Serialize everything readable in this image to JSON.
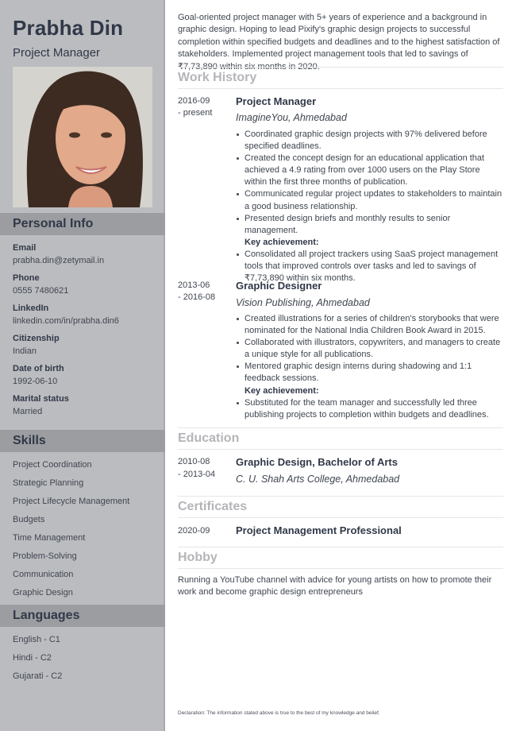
{
  "header": {
    "name": "Prabha Din",
    "role": "Project Manager"
  },
  "photo": {
    "alt": "profile-photo of smiling woman with long dark hair"
  },
  "personal_info": {
    "title": "Personal Info",
    "items": [
      {
        "label": "Email",
        "value": "prabha.din@zetymail.in"
      },
      {
        "label": "Phone",
        "value": "0555 7480621"
      },
      {
        "label": "LinkedIn",
        "value": "linkedin.com/in/prabha.din6"
      },
      {
        "label": "Citizenship",
        "value": "Indian"
      },
      {
        "label": "Date of birth",
        "value": "1992-06-10"
      },
      {
        "label": "Marital status",
        "value": "Married"
      }
    ]
  },
  "skills": {
    "title": "Skills",
    "items": [
      "Project Coordination",
      "Strategic Planning",
      "Project Lifecycle Management",
      "Budgets",
      "Time Management",
      "Problem-Solving",
      "Communication",
      "Graphic Design"
    ]
  },
  "languages": {
    "title": "Languages",
    "items": [
      "English - C1",
      "Hindi - C2",
      "Gujarati - C2"
    ]
  },
  "summary": "Goal-oriented project manager with 5+ years of experience and a background in graphic design. Hoping to lead Pixify's graphic design projects to successful completion within specified budgets and deadlines and to the highest satisfaction of stakeholders. Implemented project management tools that led to savings of ₹7,73,890 within six months in 2020.",
  "work_history": {
    "title": "Work History",
    "jobs": [
      {
        "date_start": "2016-09",
        "date_end": "- present",
        "title": "Project Manager",
        "company": "ImagineYou, Ahmedabad",
        "bullets": [
          "Coordinated graphic design projects with 97% delivered before specified deadlines.",
          "Created the concept design for an educational application that achieved a 4.9 rating from over 1000 users on the Play Store within the first three months of publication.",
          "Communicated regular project updates to stakeholders to maintain a good business relationship.",
          "Presented design briefs and monthly results to senior management."
        ],
        "key_label": "Key achievement:",
        "key_bullets": [
          "Consolidated all project trackers using SaaS project management tools that improved controls over tasks and led to savings of ₹7,73,890 within six months."
        ]
      },
      {
        "date_start": "2013-06",
        "date_end": "- 2016-08",
        "title": "Graphic Designer",
        "company": "Vision Publishing, Ahmedabad",
        "bullets": [
          "Created illustrations for a series of children's storybooks that were nominated for the National India Children Book Award in 2015.",
          "Collaborated with illustrators, copywriters, and managers to create a unique style for all publications.",
          "Mentored graphic design interns during shadowing and 1:1 feedback sessions."
        ],
        "key_label": "Key achievement:",
        "key_bullets": [
          "Substituted for the team manager and successfully led three publishing projects to completion within budgets and deadlines."
        ]
      }
    ]
  },
  "education": {
    "title": "Education",
    "date_start": "2010-08",
    "date_end": "- 2013-04",
    "degree": "Graphic Design, Bachelor of Arts",
    "school": "C. U. Shah Arts College, Ahmedabad"
  },
  "certificates": {
    "title": "Certificates",
    "date": "2020-09",
    "name": "Project Management Professional"
  },
  "hobby": {
    "title": "Hobby",
    "text": "Running a YouTube channel with advice for young artists on how to promote their work and become graphic design entrepreneurs"
  },
  "declaration": "Declaration: The information stated above is true to the best of my knowledge and belief.",
  "colors": {
    "sidebar_bg": "#bbbcbf",
    "sidebar_header_bg": "#9c9da0",
    "heading_text": "#303848",
    "section_title_text": "#b4b5b8"
  }
}
